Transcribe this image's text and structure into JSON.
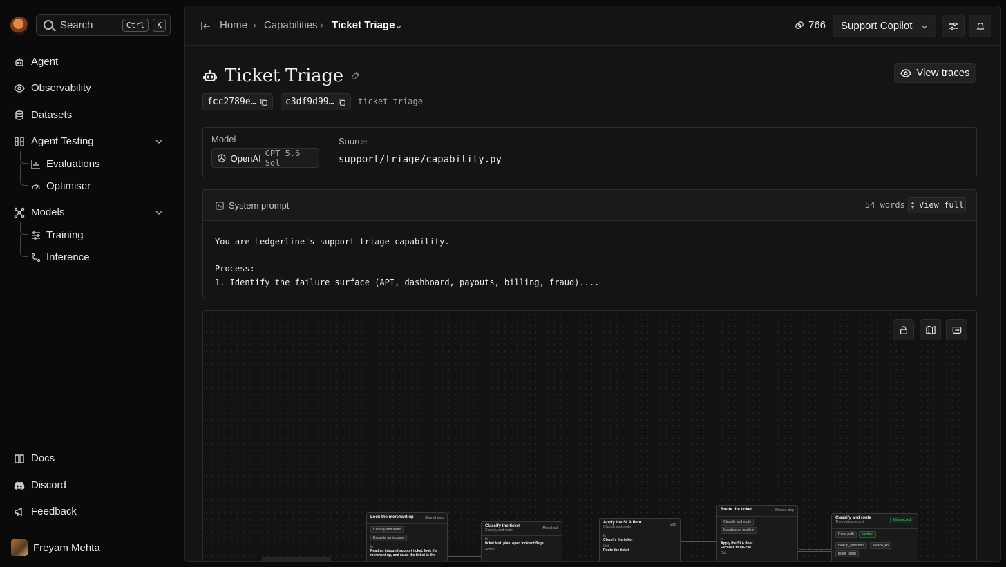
{
  "sidebar": {
    "search_label": "Search",
    "search_kbd": [
      "Ctrl",
      "K"
    ],
    "nav": {
      "agent": "Agent",
      "observability": "Observability",
      "datasets": "Datasets",
      "agent_testing": "Agent Testing",
      "evaluations": "Evaluations",
      "optimiser": "Optimiser",
      "models": "Models",
      "training": "Training",
      "inference": "Inference"
    },
    "footer": {
      "docs": "Docs",
      "discord": "Discord",
      "feedback": "Feedback"
    },
    "user_name": "Freyam Mehta"
  },
  "topbar": {
    "breadcrumb": [
      "Home",
      "Capabilities"
    ],
    "current": "Ticket Triage",
    "credits": "766",
    "project": "Support Copilot"
  },
  "page": {
    "title": "Ticket Triage",
    "view_traces": "View traces",
    "ids": [
      "fcc2789e…",
      "c3df9d99…"
    ],
    "slug": "ticket-triage"
  },
  "info": {
    "model_label": "Model",
    "model_provider": "OpenAI",
    "model_name": "GPT 5.6 Sol",
    "source_label": "Source",
    "source_path": "support/triage/capability.py"
  },
  "prompt": {
    "title": "System prompt",
    "word_count": "54 words",
    "view_full": "View full",
    "lines": [
      "You are Ledgerline's support triage capability.",
      "",
      "Process:",
      "1. Identify the failure surface (API, dashboard, payouts, billing, fraud)...."
    ]
  },
  "graph": {
    "nodes": [
      {
        "title": "Look the merchant up",
        "tag": "Shared step",
        "pills": [
          "Classify and route",
          "Escalate an incident"
        ],
        "in_label": "In",
        "in_text": "Read an inbound support ticket, look the merchant up, and route the ticket to the"
      },
      {
        "title": "Classify the ticket",
        "subtitle": "Classify and route",
        "tag": "Model call",
        "in_label": "In",
        "in_text": "ticket text, plan, open incident flags",
        "action_label": "Action"
      },
      {
        "title": "Apply the SLA floor",
        "subtitle": "Classify and route",
        "tag": "Step",
        "in_label": "In",
        "in_text": "Classify the ticket",
        "out_label": "Out",
        "out_text": "Route the ticket"
      },
      {
        "title": "Route the ticket",
        "tag": "Shared step",
        "pills": [
          "Classify and route",
          "Escalate an incident"
        ],
        "in_label": "In",
        "in_text": "Apply the SLA floor",
        "in_text2": "Escalate to on-call",
        "out_label": "Out"
      },
      {
        "title": "Classify and route",
        "subtitle": "The routing record.",
        "tag": "Exits record",
        "row1": [
          "Code path",
          "Verified"
        ],
        "tools": [
          "lookup_merchant",
          "search_kb",
          "route_ticket"
        ]
      }
    ],
    "edge_label": "ticket without an open incid"
  }
}
